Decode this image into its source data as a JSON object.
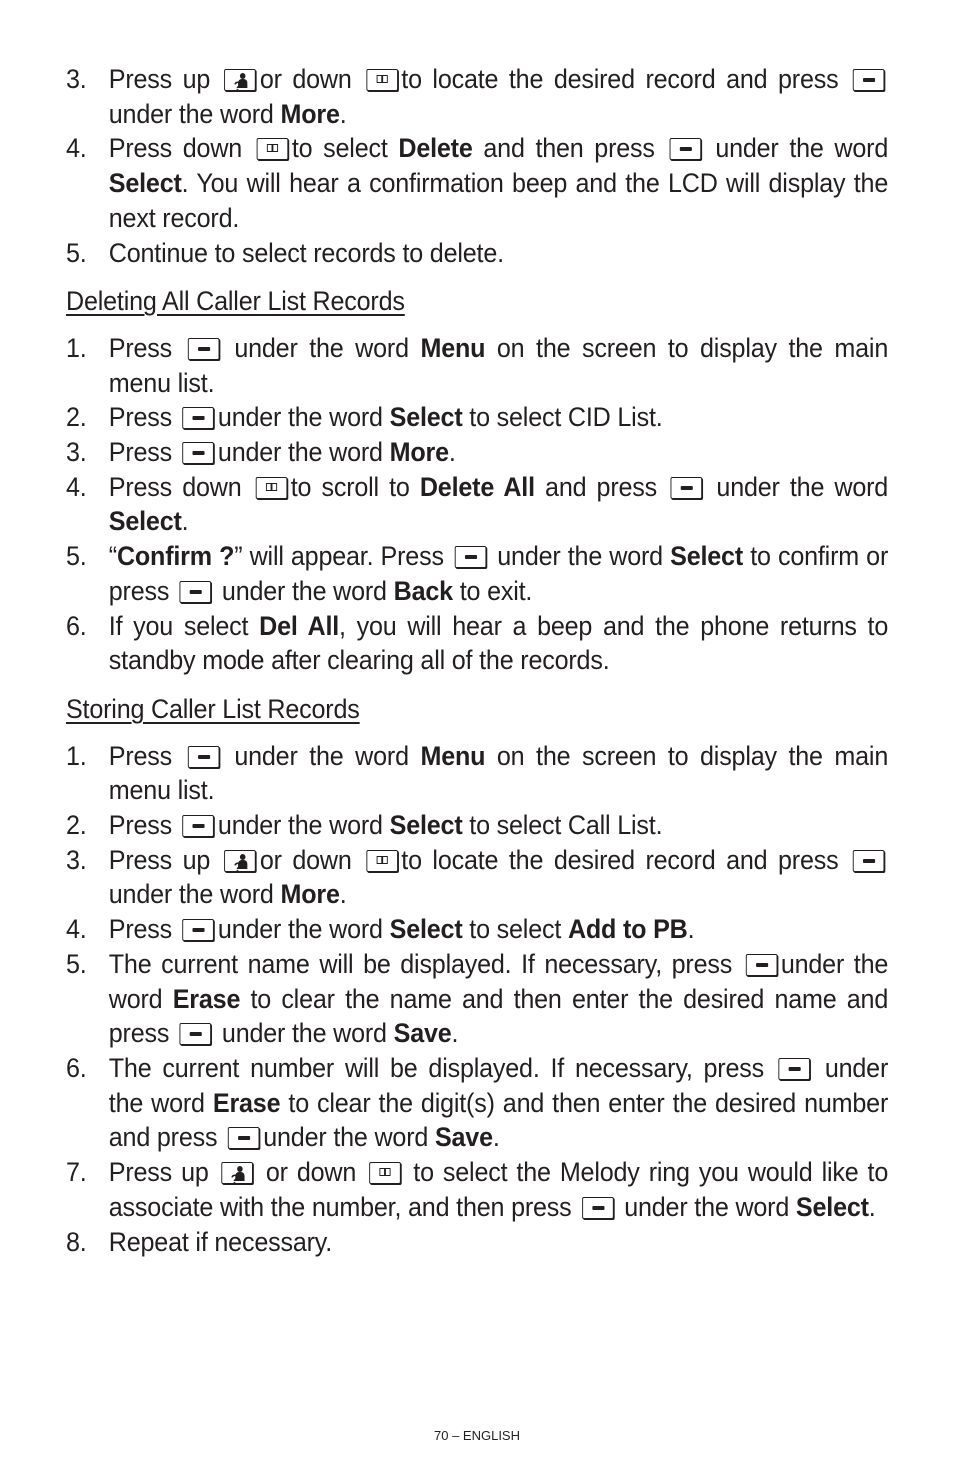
{
  "icons": {
    "soft_key": "soft-key-icon",
    "up_key": "up-key-icon",
    "down_key": "down-key-icon"
  },
  "section_top": {
    "items": [
      {
        "num": "3.",
        "parts": [
          "Press up",
          "or down",
          "to locate the desired record and press",
          "under the word",
          "More",
          "."
        ]
      },
      {
        "num": "4.",
        "parts": [
          "Press down",
          "to select",
          "Delete",
          "and then press",
          "under the word",
          "Select",
          ". You will hear a confirmation beep and the LCD will display the next record."
        ]
      },
      {
        "num": "5.",
        "parts": [
          "Continue to select records to delete."
        ]
      }
    ]
  },
  "section_delete_all": {
    "heading": "Deleting All Caller List Records",
    "items": [
      {
        "num": "1.",
        "parts": [
          "Press",
          "under the word",
          "Menu",
          "on the screen to display the main menu list."
        ]
      },
      {
        "num": "2.",
        "parts": [
          "Press",
          "under the word",
          "Select",
          "to select CID List."
        ]
      },
      {
        "num": "3.",
        "parts": [
          "Press",
          "under the word",
          "More",
          "."
        ]
      },
      {
        "num": "4.",
        "parts": [
          "Press down",
          "to scroll to",
          "Delete All",
          "and press",
          "under the word",
          "Select",
          "."
        ]
      },
      {
        "num": "5.",
        "parts": [
          "“",
          "Confirm ?",
          "” will appear. Press",
          "under the word",
          "Select",
          "to confirm or press",
          "under the word",
          "Back",
          "to exit."
        ]
      },
      {
        "num": "6.",
        "parts": [
          "If you select",
          "Del All",
          ", you will hear a beep and the phone returns to standby mode after clearing all of the records."
        ]
      }
    ]
  },
  "section_storing": {
    "heading": "Storing Caller List Records",
    "items": [
      {
        "num": "1.",
        "parts": [
          "Press",
          "under the word",
          "Menu",
          "on the screen to display the main menu list."
        ]
      },
      {
        "num": "2.",
        "parts": [
          "Press",
          "under the word",
          "Select",
          "to select Call List."
        ]
      },
      {
        "num": "3.",
        "parts": [
          "Press up",
          "or down",
          "to locate the desired record and press",
          "under the word",
          "More",
          "."
        ]
      },
      {
        "num": "4.",
        "parts": [
          "Press",
          "under the word",
          "Select",
          "to select",
          "Add to PB",
          "."
        ]
      },
      {
        "num": "5.",
        "parts": [
          "The current name will be displayed. If necessary, press",
          "under the word",
          "Erase",
          "to clear the name and then enter the desired name and press",
          "under the word",
          "Save",
          "."
        ]
      },
      {
        "num": "6.",
        "parts": [
          "The current number will be displayed. If necessary, press",
          "under the word",
          "Erase",
          "to clear the digit(s) and then enter the desired number and press",
          "under the word",
          "Save",
          "."
        ]
      },
      {
        "num": "7.",
        "parts": [
          "Press up",
          "or down",
          "to select the Melody ring you would like to associate with the number, and then press",
          "under the word",
          "Select",
          "."
        ]
      },
      {
        "num": "8.",
        "parts": [
          "Repeat if necessary."
        ]
      }
    ]
  },
  "footer": {
    "page_label": "70 – ENGLISH"
  }
}
